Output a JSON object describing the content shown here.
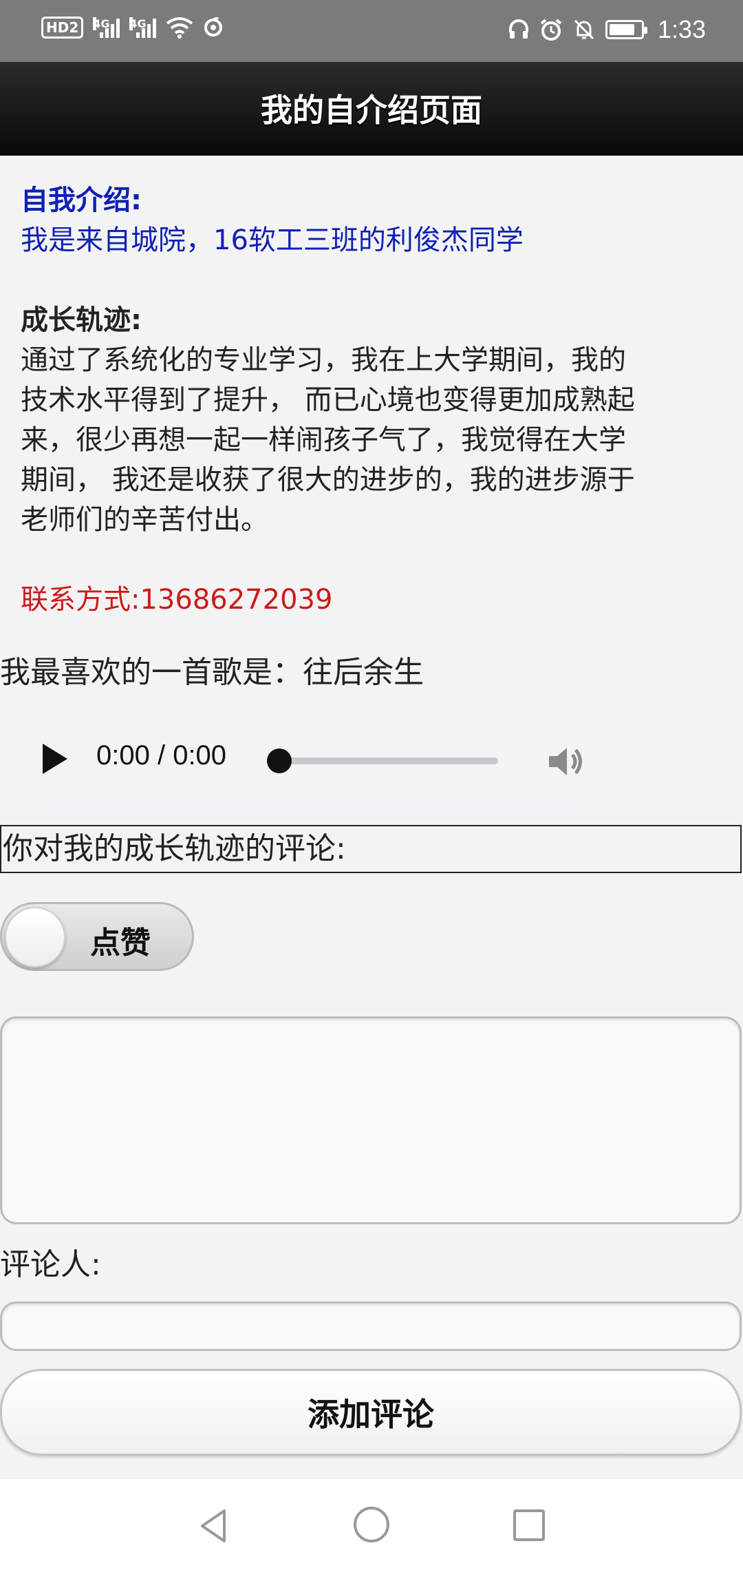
{
  "status_bar": {
    "hd_label": "HD2",
    "network_1": "4G",
    "network_2": "4G",
    "time": "1:33",
    "icons": [
      "hd-icon",
      "signal-icon",
      "signal-icon",
      "wifi-icon",
      "data-sync-icon",
      "headphones-icon",
      "alarm-icon",
      "bell-off-icon",
      "battery-icon"
    ]
  },
  "header": {
    "title": "我的自介绍页面"
  },
  "intro": {
    "heading": "自我介绍:",
    "text": "我是来自城院，16软工三班的利俊杰同学"
  },
  "growth": {
    "heading": "成长轨迹:",
    "lines": [
      "通过了系统化的专业学习，我在上大学期间，我的",
      "技术水平得到了提升， 而已心境也变得更加成熟起",
      "来，很少再想一起一样闹孩子气了，我觉得在大学",
      "期间， 我还是收获了很大的进步的，我的进步源于",
      "老师们的辛苦付出。"
    ]
  },
  "contact": {
    "text": "联系方式:13686272039"
  },
  "song": {
    "text": "我最喜欢的一首歌是：往后余生"
  },
  "audio": {
    "time": "0:00 / 0:00",
    "progress": 0
  },
  "comment": {
    "label": "你对我的成长轨迹的评论:",
    "like_label": "点赞",
    "like_on": false,
    "textarea_value": "",
    "commenter_label": "评论人:",
    "commenter_value": "",
    "add_button": "添加评论"
  },
  "colors": {
    "intro": "#1020b4",
    "contact": "#cc1a1a",
    "header_bg": "#111111"
  }
}
